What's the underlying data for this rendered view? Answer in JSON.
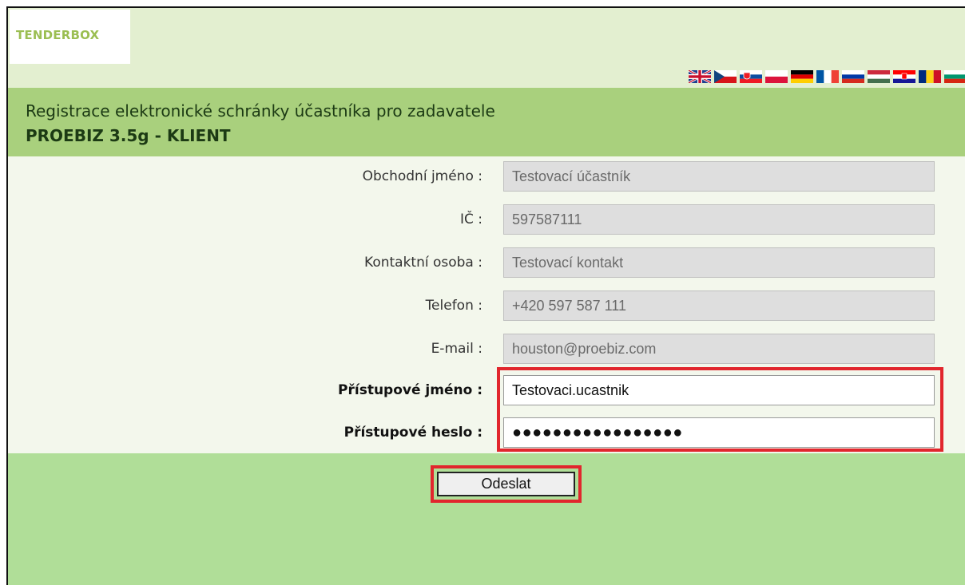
{
  "logo": {
    "text": "TENDERBOX"
  },
  "flags": [
    {
      "name": "uk-flag"
    },
    {
      "name": "czech-flag"
    },
    {
      "name": "slovak-flag"
    },
    {
      "name": "polish-flag"
    },
    {
      "name": "german-flag"
    },
    {
      "name": "french-flag"
    },
    {
      "name": "russian-flag"
    },
    {
      "name": "hungarian-flag"
    },
    {
      "name": "croatian-flag"
    },
    {
      "name": "romanian-flag"
    },
    {
      "name": "bulgarian-flag"
    }
  ],
  "header": {
    "title": "Registrace elektronické schránky účastníka pro zadavatele",
    "subtitle": "PROEBIZ 3.5g - KLIENT"
  },
  "form": {
    "business_name": {
      "label": "Obchodní jméno :",
      "value": "Testovací účastník"
    },
    "ic": {
      "label": "IČ :",
      "value": "597587111"
    },
    "contact": {
      "label": "Kontaktní osoba :",
      "value": "Testovací kontakt"
    },
    "phone": {
      "label": "Telefon :",
      "value": "+420 597 587 111"
    },
    "email": {
      "label": "E-mail :",
      "value": "houston@proebiz.com"
    },
    "username": {
      "label": "Přístupové jméno :",
      "value": "Testovaci.ucastnik"
    },
    "password": {
      "label": "Přístupové heslo :",
      "value": "●●●●●●●●●●●●●●●●●"
    }
  },
  "actions": {
    "submit_label": "Odeslat"
  },
  "colors": {
    "frame_bg": "#e3efd0",
    "title_bar": "#a9d07d",
    "bottom_bar": "#b0de98",
    "highlight": "#e1262d",
    "logo": "#9bbe52"
  }
}
